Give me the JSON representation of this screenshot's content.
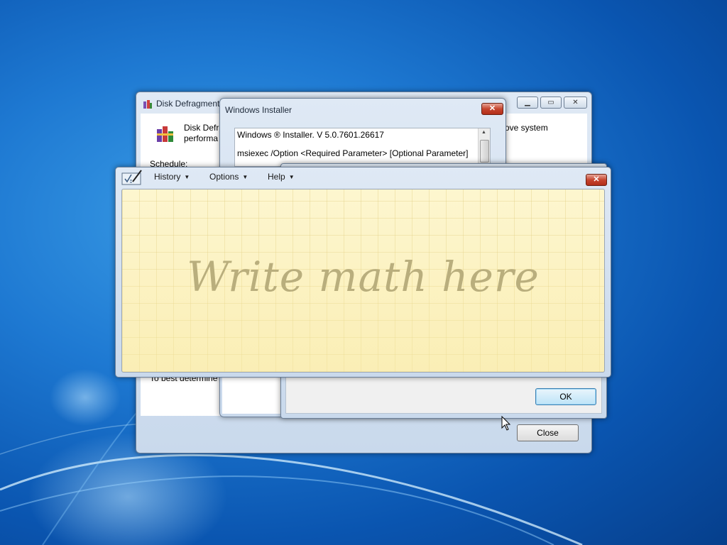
{
  "disk_defrag": {
    "title": "Disk Defragment",
    "desc_line1": "Disk Defra",
    "desc_line2": "performa",
    "desc_right": "ove system",
    "schedule_label": "Schedule:",
    "lower_text": "To best determine",
    "close_label": "Close",
    "minimize_icon": "minimize-icon",
    "maximize_icon": "maximize-icon",
    "close_icon": "close-icon"
  },
  "installer": {
    "title": "Windows Installer",
    "line1": "Windows ® Installer. V 5.0.7601.26617",
    "line2": "msiexec /Option <Required Parameter> [Optional Parameter]",
    "ok_label": "OK",
    "close_glyph": "✕"
  },
  "math_panel": {
    "menus": [
      {
        "label": "History"
      },
      {
        "label": "Options"
      },
      {
        "label": "Help"
      }
    ],
    "hint": "Write math here",
    "close_glyph": "✕"
  }
}
